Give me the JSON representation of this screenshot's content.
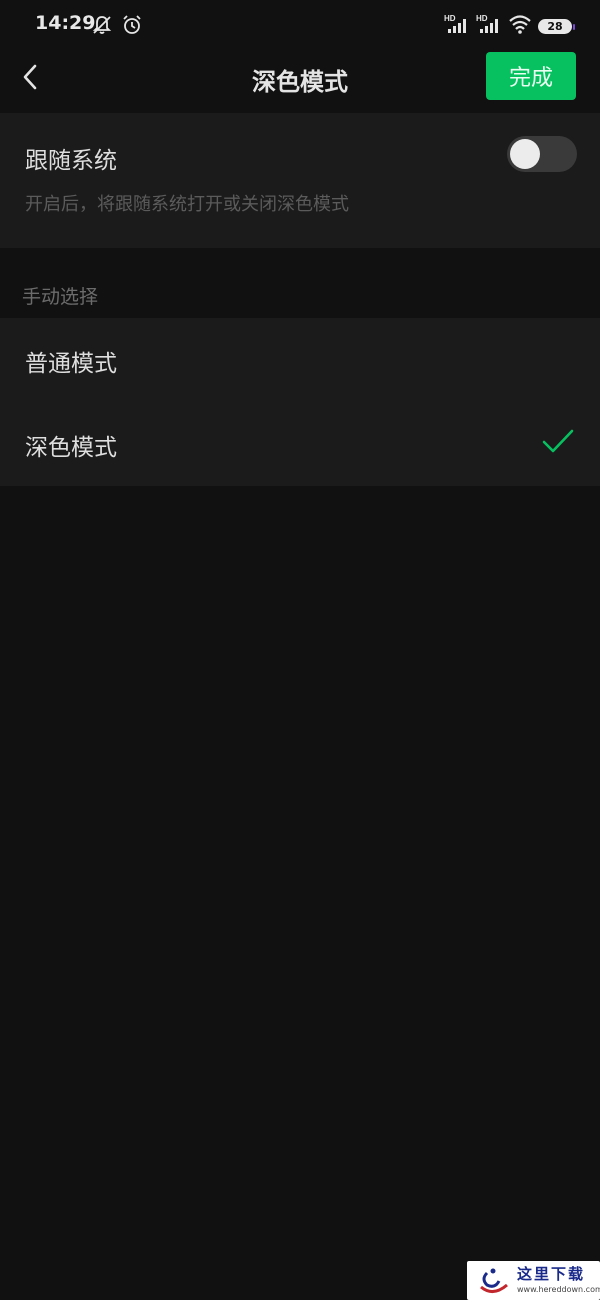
{
  "status_bar": {
    "time": "14:29",
    "icons_left": [
      "notifications-off-icon",
      "alarm-icon"
    ],
    "icons_right": [
      "hd-signal-icon",
      "hd-signal-icon",
      "wifi-icon"
    ],
    "battery": "28"
  },
  "nav": {
    "back_icon": "chevron-left-icon",
    "title": "深色模式",
    "done_label": "完成"
  },
  "follow_system": {
    "label": "跟随系统",
    "description": "开启后，将跟随系统打开或关闭深色模式",
    "enabled": false
  },
  "manual": {
    "section_title": "手动选择",
    "options": [
      {
        "label": "普通模式",
        "selected": false
      },
      {
        "label": "深色模式",
        "selected": true
      }
    ]
  },
  "colors": {
    "accent": "#07c160",
    "background": "#111111",
    "card": "#1b1b1b"
  },
  "watermark": {
    "text": "这里下载",
    "url": "www.hereddown.com"
  }
}
